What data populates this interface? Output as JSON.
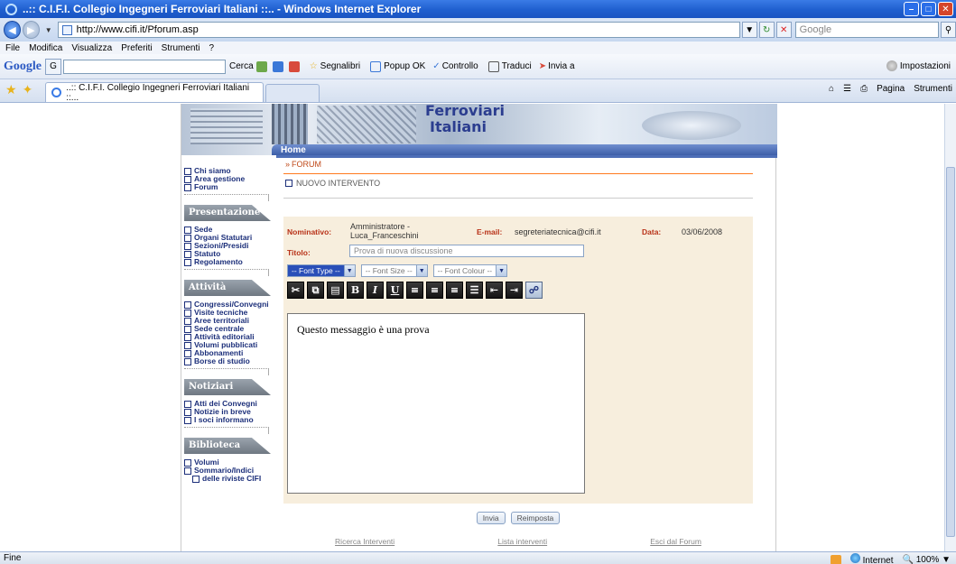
{
  "window": {
    "title": "..:: C.I.F.I. Collegio Ingegneri Ferroviari Italiani ::.. - Windows Internet Explorer"
  },
  "address": {
    "url": "http://www.cifi.it/Pforum.asp",
    "search_placeholder": "Google"
  },
  "menu": [
    "File",
    "Modifica",
    "Visualizza",
    "Preferiti",
    "Strumenti",
    "?"
  ],
  "google_bar": {
    "logo": "Google",
    "search_label": "Cerca",
    "bookmarks": "Segnalibri",
    "popup": "Popup OK",
    "check": "Controllo",
    "translate": "Traduci",
    "send": "Invia a",
    "settings": "Impostazioni"
  },
  "tabs": [
    {
      "label": "..:: C.I.F.I. Collegio Ingegneri Ferroviari Italiani ::..."
    }
  ],
  "tab_tools": {
    "page": "Pagina",
    "tools": "Strumenti"
  },
  "banner": {
    "title1": "Ferroviari",
    "title2": "Italiani",
    "home": "Home"
  },
  "nav": {
    "top": [
      "Chi siamo",
      "Area gestione",
      "Forum"
    ],
    "sections": [
      {
        "title": "Presentazione",
        "items": [
          "Sede",
          "Organi Statutari",
          "Sezioni/Presidi",
          "Statuto",
          "Regolamento"
        ]
      },
      {
        "title": "Attività",
        "items": [
          "Congressi/Convegni",
          "Visite tecniche",
          "Aree territoriali",
          "Sede centrale",
          "Attività editoriali",
          "Volumi pubblicati",
          "Abbonamenti",
          "Borse di studio"
        ]
      },
      {
        "title": "Notiziari",
        "items": [
          "Atti dei Convegni",
          "Notizie in breve",
          "I soci informano"
        ]
      },
      {
        "title": "Biblioteca",
        "items": [
          "Volumi",
          "Sommario/Indici",
          "delle riviste CIFI"
        ]
      }
    ]
  },
  "main": {
    "forum": "FORUM",
    "nuovo": "NUOVO INTERVENTO",
    "nominativo_label": "Nominativo:",
    "nominativo_value1": "Amministratore -",
    "nominativo_value2": "Luca_Franceschini",
    "email_label": "E-mail:",
    "email_value": "segreteriatecnica@cifi.it",
    "data_label": "Data:",
    "data_value": "03/06/2008",
    "titolo_label": "Titolo:",
    "titolo_value": "Prova di nuova discussione",
    "font_type": "-- Font Type --",
    "font_size": "-- Font Size --",
    "font_colour": "-- Font Colour --",
    "message": "Questo messaggio è una prova",
    "send_button": "Invia",
    "reset_button": "Reimposta",
    "links": [
      "Ricerca Interventi",
      "Lista interventi",
      "Esci dal Forum"
    ]
  },
  "status": {
    "left": "Fine",
    "zone": "Internet",
    "zoom": "100%"
  }
}
